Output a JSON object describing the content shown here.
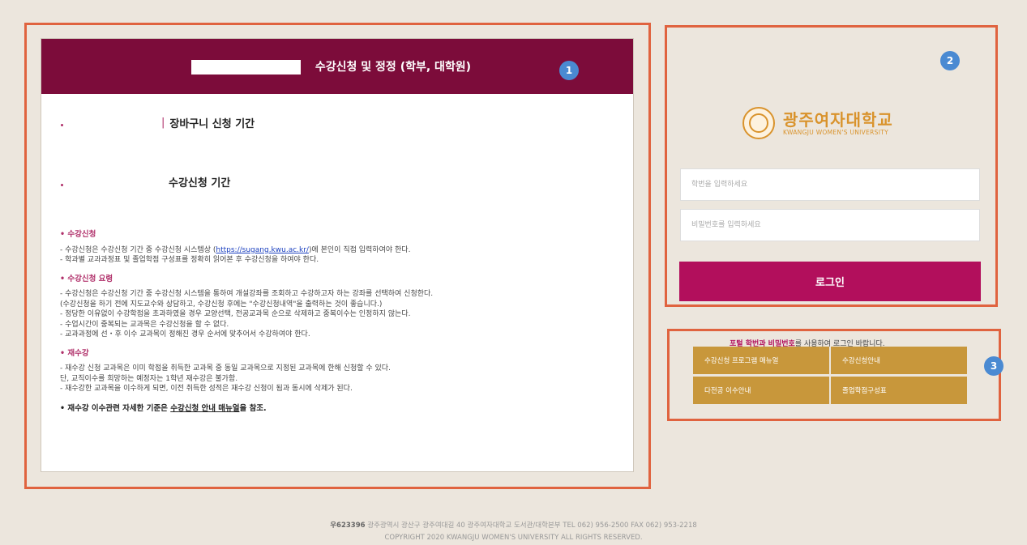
{
  "callouts": [
    "1",
    "2",
    "3"
  ],
  "main": {
    "title": "수강신청 및 정정 (학부, 대학원)",
    "periods": [
      {
        "label": "장바구니 신청 기간"
      },
      {
        "label": "수강신청 기간"
      }
    ],
    "sections": [
      {
        "heading": "• 수강신청",
        "lines": [
          {
            "pre": "- 수강신청은 수강신청 기간 중 수강신청 시스템상 (",
            "link": "https://sugang.kwu.ac.kr/",
            "post": ")에 본인이 직접 입력하여야 한다."
          },
          {
            "pre": "- 학과별 교과과정표 및 졸업학점 구성표를 정확히 읽어본 후 수강신청을 하여야 한다."
          }
        ]
      },
      {
        "heading": "• 수강신청 요령",
        "lines": [
          {
            "pre": "- 수강신청은 수강신청 기간 중 수강신청 시스템을 통하여 개설강좌를 조회하고 수강하고자 하는 강좌를 선택하여 신청한다."
          },
          {
            "pre": "  (수강신청을 하기 전에 지도교수와 상담하고, 수강신청 후에는 \"수강신청내역\"을 출력하는 것이 좋습니다.)"
          },
          {
            "pre": "- 정당한 이유없이 수강학점을 초과하였을 경우 교양선택, 전공교과목 순으로 삭제하고 중복이수는 인정하지 않는다."
          },
          {
            "pre": "- 수업시간이 중복되는 교과목은 수강신청을 할 수 없다."
          },
          {
            "pre": "- 교과과정에 선・후 이수 교과목이 정해진 경우 순서에 맞추어서 수강하여야 한다."
          }
        ]
      },
      {
        "heading": "• 재수강",
        "lines": [
          {
            "pre": "- 재수강 신청 교과목은 이미 학점을 취득한 교과목 중 동일 교과목으로 지정된 교과목에 한해 신청할 수 있다."
          },
          {
            "pre": "  단, 교직이수를 희망하는 예정자는 1학년 재수강은 불가함."
          },
          {
            "pre": "- 재수강한 교과목을 이수하게 되면, 이전 취득한 성적은 재수강 신청이 됨과 동시에 삭제가 된다."
          }
        ]
      }
    ],
    "final_note": {
      "pre": "• 재수강 이수관련 자세한 기준은 ",
      "underline": "수강신청 안내 매뉴얼",
      "post": "을 참조."
    }
  },
  "login": {
    "logo_ko": "광주여자대학교",
    "logo_en": "KWANGJU WOMEN'S UNIVERSITY",
    "id_placeholder": "학번을 입력하세요",
    "pw_placeholder": "비밀번호를 입력하세요",
    "button": "로그인",
    "notice_em": "포털 학번과 비밀번호",
    "notice_rest": "를 사용하여 로그인 바랍니다."
  },
  "quick_links": [
    "수강신청 프로그램 매뉴얼",
    "수강신청안내",
    "다전공 이수안내",
    "졸업학점구성표"
  ],
  "footer": {
    "postal": "우623396",
    "address": " 광주광역시 광산구 광주여대길 40 광주여자대학교 도서관/대학본부 TEL 062) 956-2500 FAX 062) 953-2218",
    "copyright": "COPYRIGHT 2020 KWANGJU WOMEN'S UNIVERSITY ALL RIGHTS RESERVED."
  },
  "colors": {
    "accent": "#7c0c3a",
    "button": "#b20f5c",
    "gold": "#c8973b",
    "callout": "#e0633f",
    "badge": "#4a8ad2"
  }
}
